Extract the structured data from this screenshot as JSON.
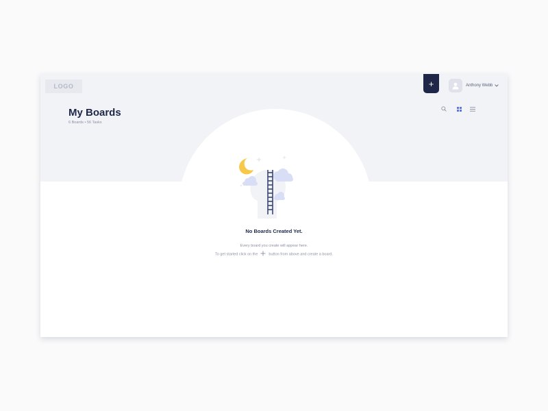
{
  "header": {
    "logo_text": "LOGO",
    "add_button_label": "+",
    "user_name": "Anthony Webb",
    "icons": {
      "add": "plus-icon",
      "avatar": "user-icon",
      "menu": "chevron-down-icon"
    }
  },
  "page": {
    "title": "My Boards",
    "subtitle": "6 Boards • 56 Tasks"
  },
  "view_controls": [
    {
      "name": "search",
      "icon": "search-icon",
      "active": false
    },
    {
      "name": "grid-view",
      "icon": "grid-icon",
      "active": true
    },
    {
      "name": "list-view",
      "icon": "list-icon",
      "active": false
    }
  ],
  "empty_state": {
    "title": "No Boards Created Yet.",
    "line1": "Every board you create will appear here.",
    "line2_before": "To get started click on the",
    "line2_after": "button from above and create a board.",
    "illustration": "head-ladder-moon-clouds"
  },
  "colors": {
    "navy": "#1e2748",
    "accent": "#5b73e8",
    "band": "#f2f3f6",
    "page_bg": "#fafafb",
    "moon": "#f7c84a",
    "clouds": "#d9def7"
  }
}
